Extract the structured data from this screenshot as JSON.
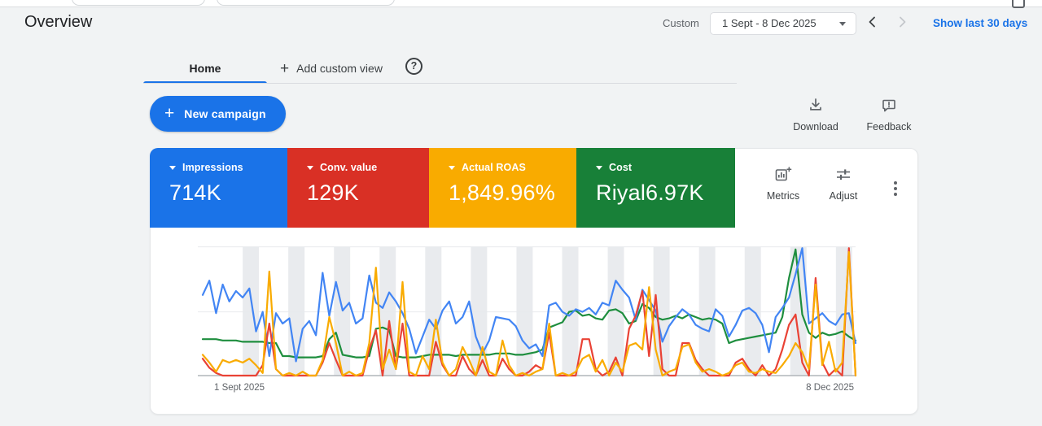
{
  "header": {
    "title": "Overview"
  },
  "datebar": {
    "custom_label": "Custom",
    "range": "1 Sept - 8 Dec 2025",
    "show_last_link": "Show last 30 days"
  },
  "tabs": {
    "home": "Home",
    "add_plus": "+",
    "add_custom_view": "Add custom view",
    "help_glyph": "?"
  },
  "toolbar": {
    "new_campaign_plus": "+",
    "new_campaign": "New campaign",
    "download": "Download",
    "feedback": "Feedback"
  },
  "tools": {
    "metrics": "Metrics",
    "adjust": "Adjust"
  },
  "accent_color": "#1a73e8",
  "cards": [
    {
      "label": "Impressions",
      "value": "714K",
      "color": "#1a73e8"
    },
    {
      "label": "Conv. value",
      "value": "129K",
      "color": "#d93025"
    },
    {
      "label": "Actual ROAS",
      "value": "1,849.96%",
      "color": "#f9ab00"
    },
    {
      "label": "Cost",
      "value": "Riyal6.97K",
      "color": "#188038"
    }
  ],
  "chart_data": {
    "type": "line",
    "title": "",
    "xlabel": "",
    "ylabel": "",
    "legend_position": "none",
    "grid": "horizontal gridlines plus weekly weekend shading bands",
    "ylim": [
      0,
      100
    ],
    "y_scale_note": "normalized 0-100, no y tick labels shown in UI",
    "x_axis": {
      "start_label": "1 Sept 2025",
      "end_label": "8 Dec 2025",
      "days": 99
    },
    "gridlines_y_values": [
      49,
      99
    ],
    "weekend_bands": {
      "start_day": 6,
      "period_days": 6.85,
      "width_days": 2.44,
      "count": 14,
      "color": "#e9ebee"
    },
    "series": [
      {
        "name": "Impressions",
        "color": "#4285f4",
        "values": [
          62,
          73,
          48,
          70,
          57,
          65,
          60,
          67,
          34,
          49,
          15,
          48,
          40,
          44,
          11,
          36,
          42,
          31,
          79,
          46,
          72,
          50,
          56,
          40,
          44,
          77,
          56,
          52,
          64,
          57,
          48,
          36,
          17,
          30,
          43,
          36,
          50,
          57,
          40,
          45,
          57,
          30,
          17,
          27,
          45,
          44,
          43,
          38,
          27,
          21,
          24,
          15,
          54,
          56,
          49,
          46,
          51,
          49,
          52,
          47,
          56,
          54,
          73,
          66,
          60,
          43,
          66,
          58,
          50,
          26,
          38,
          45,
          51,
          47,
          39,
          36,
          34,
          51,
          46,
          30,
          39,
          50,
          52,
          48,
          39,
          18,
          45,
          52,
          60,
          78,
          98,
          40,
          44,
          48,
          42,
          39,
          47,
          48,
          25
        ]
      },
      {
        "name": "Conv. value",
        "color": "#e94235",
        "values": [
          13,
          6,
          2,
          0,
          0,
          0,
          0,
          0,
          0,
          8,
          40,
          5,
          0,
          0,
          0,
          0,
          0,
          0,
          10,
          25,
          12,
          0,
          0,
          0,
          0,
          20,
          35,
          0,
          42,
          5,
          40,
          0,
          0,
          0,
          0,
          26,
          8,
          0,
          0,
          15,
          5,
          0,
          12,
          0,
          0,
          13,
          5,
          0,
          0,
          3,
          8,
          5,
          33,
          0,
          0,
          0,
          0,
          28,
          28,
          5,
          0,
          3,
          14,
          0,
          36,
          46,
          65,
          15,
          62,
          5,
          0,
          0,
          25,
          25,
          12,
          5,
          0,
          0,
          0,
          0,
          10,
          13,
          5,
          0,
          8,
          0,
          5,
          20,
          39,
          47,
          10,
          0,
          75,
          10,
          0,
          5,
          0,
          98,
          0
        ]
      },
      {
        "name": "Actual ROAS",
        "color": "#f9ab00",
        "values": [
          16,
          10,
          3,
          12,
          10,
          12,
          10,
          13,
          8,
          2,
          80,
          5,
          0,
          2,
          0,
          3,
          0,
          0,
          12,
          45,
          25,
          0,
          3,
          0,
          2,
          25,
          83,
          5,
          20,
          5,
          72,
          3,
          0,
          15,
          5,
          43,
          10,
          0,
          5,
          22,
          12,
          0,
          22,
          3,
          0,
          27,
          8,
          0,
          2,
          0,
          3,
          5,
          40,
          0,
          2,
          0,
          3,
          13,
          16,
          3,
          12,
          0,
          10,
          3,
          23,
          25,
          20,
          68,
          20,
          0,
          3,
          5,
          22,
          24,
          10,
          3,
          5,
          3,
          0,
          2,
          8,
          10,
          3,
          2,
          5,
          3,
          2,
          8,
          15,
          25,
          18,
          5,
          70,
          8,
          26,
          3,
          10,
          95,
          0
        ]
      },
      {
        "name": "Cost",
        "color": "#1e8e3e",
        "values": [
          28,
          28,
          28,
          27,
          27,
          27,
          26,
          26,
          26,
          26,
          25,
          25,
          15,
          15,
          14,
          14,
          14,
          14,
          15,
          28,
          33,
          16,
          15,
          14,
          14,
          15,
          36,
          37,
          35,
          15,
          14,
          14,
          14,
          15,
          16,
          16,
          16,
          16,
          15,
          16,
          16,
          16,
          16,
          16,
          17,
          17,
          17,
          16,
          16,
          17,
          18,
          20,
          37,
          39,
          41,
          49,
          50,
          46,
          47,
          44,
          43,
          50,
          51,
          48,
          40,
          42,
          55,
          52,
          45,
          43,
          44,
          46,
          44,
          47,
          45,
          43,
          44,
          43,
          40,
          25,
          27,
          28,
          29,
          30,
          31,
          32,
          33,
          45,
          75,
          97,
          47,
          33,
          29,
          33,
          31,
          32,
          34,
          30,
          27
        ]
      }
    ]
  }
}
